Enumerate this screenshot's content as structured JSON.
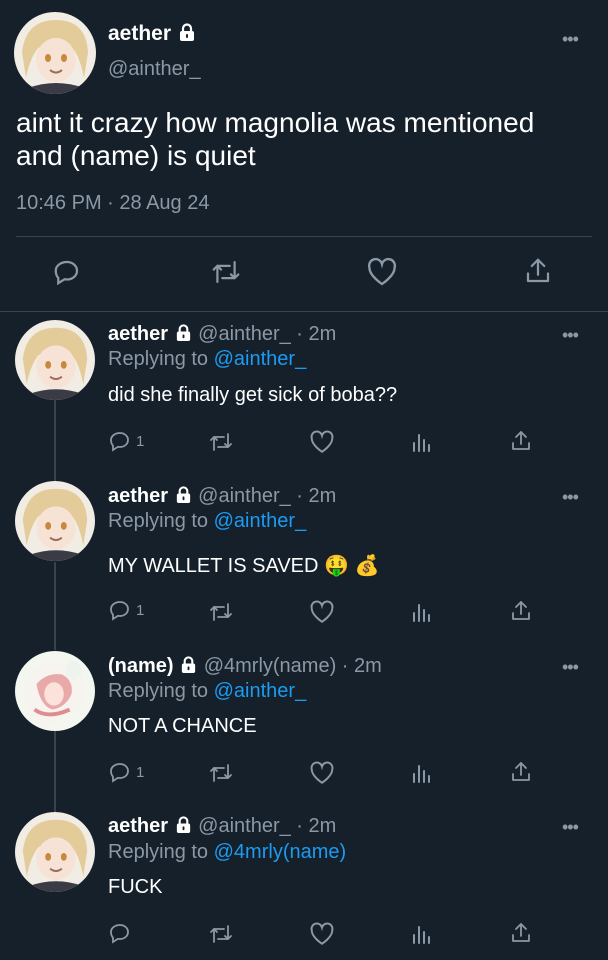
{
  "main": {
    "display_name": "aether",
    "handle": "@ainther_",
    "text_line1": "aint it crazy how magnolia was mentioned",
    "text_line2": "and (name) is quiet",
    "timestamp": "10:46 PM · 28 Aug 24"
  },
  "replies": [
    {
      "display_name": "aether",
      "handle_time": "@ainther_ · 2m",
      "replying_label": "Replying to",
      "replying_to": "@ainther_",
      "text": "did she finally get sick of boba??",
      "reply_count": "1"
    },
    {
      "display_name": "aether",
      "handle_time": "@ainther_ · 2m",
      "replying_label": "Replying to",
      "replying_to": "@ainther_",
      "text": "MY WALLET IS SAVED 🤑 💰",
      "reply_count": "1"
    },
    {
      "display_name": "(name)",
      "handle_time": "@4mrly(name) · 2m",
      "replying_label": "Replying to",
      "replying_to": "@ainther_",
      "text": "NOT A CHANCE",
      "reply_count": "1"
    },
    {
      "display_name": "aether",
      "handle_time": "@ainther_ · 2m",
      "replying_label": "Replying to",
      "replying_to": "@4mrly(name)",
      "text": "FUCK",
      "reply_count": ""
    }
  ],
  "more_glyph": "•••",
  "icons": [
    "reply-icon",
    "retweet-icon",
    "like-icon",
    "analytics-icon",
    "share-icon",
    "lock-icon",
    "more-icon"
  ],
  "colors": {
    "background": "#15202b",
    "text": "#ffffff",
    "muted": "#8b98a5",
    "link": "#1d9bf0",
    "divider": "#38444d"
  }
}
